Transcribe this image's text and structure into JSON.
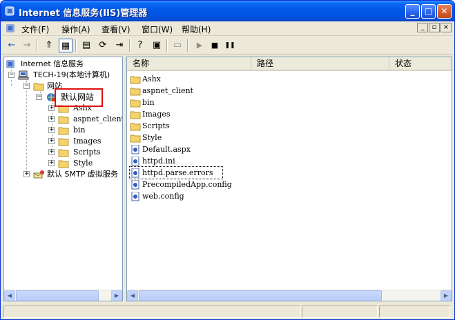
{
  "window": {
    "title": "Internet 信息服务(IIS)管理器",
    "minimize_glyph": "_",
    "maximize_glyph": "□",
    "close_glyph": "✕"
  },
  "menu": {
    "items": [
      {
        "label": "文件(F)"
      },
      {
        "label": "操作(A)"
      },
      {
        "label": "查看(V)"
      },
      {
        "label": "窗口(W)"
      },
      {
        "label": "帮助(H)"
      }
    ],
    "mdi_minimize": "_",
    "mdi_restore": "▫",
    "mdi_close": "×"
  },
  "toolbar": {
    "back": "←",
    "forward": "→",
    "up": "⇑",
    "show_tree": "▦",
    "properties": "▤",
    "refresh": "⟳",
    "export": "⇥",
    "help": "?",
    "view": "▣",
    "computer": "▭",
    "play": "▶",
    "stop": "■",
    "pause": "❚❚"
  },
  "tree": {
    "root": "Internet 信息服务",
    "computer": "TECH-19(本地计算机)",
    "websites": "网站",
    "default_site": "默认网站",
    "children": [
      "Ashx",
      "aspnet_client",
      "bin",
      "Images",
      "Scripts",
      "Style"
    ],
    "smtp": "默认 SMTP 虚拟服务"
  },
  "list": {
    "columns": [
      "名称",
      "路径",
      "状态"
    ],
    "items": [
      {
        "name": "Ashx",
        "type": "folder"
      },
      {
        "name": "aspnet_client",
        "type": "folder"
      },
      {
        "name": "bin",
        "type": "folder"
      },
      {
        "name": "Images",
        "type": "folder"
      },
      {
        "name": "Scripts",
        "type": "folder"
      },
      {
        "name": "Style",
        "type": "folder"
      },
      {
        "name": "Default.aspx",
        "type": "file"
      },
      {
        "name": "httpd.ini",
        "type": "file"
      },
      {
        "name": "httpd.parse.errors",
        "type": "file"
      },
      {
        "name": "PrecompiledApp.config",
        "type": "file"
      },
      {
        "name": "web.config",
        "type": "file"
      }
    ]
  },
  "colors": {
    "title_bar": "#0054e3",
    "highlight": "#e01010",
    "folder": "#f5d36b"
  }
}
